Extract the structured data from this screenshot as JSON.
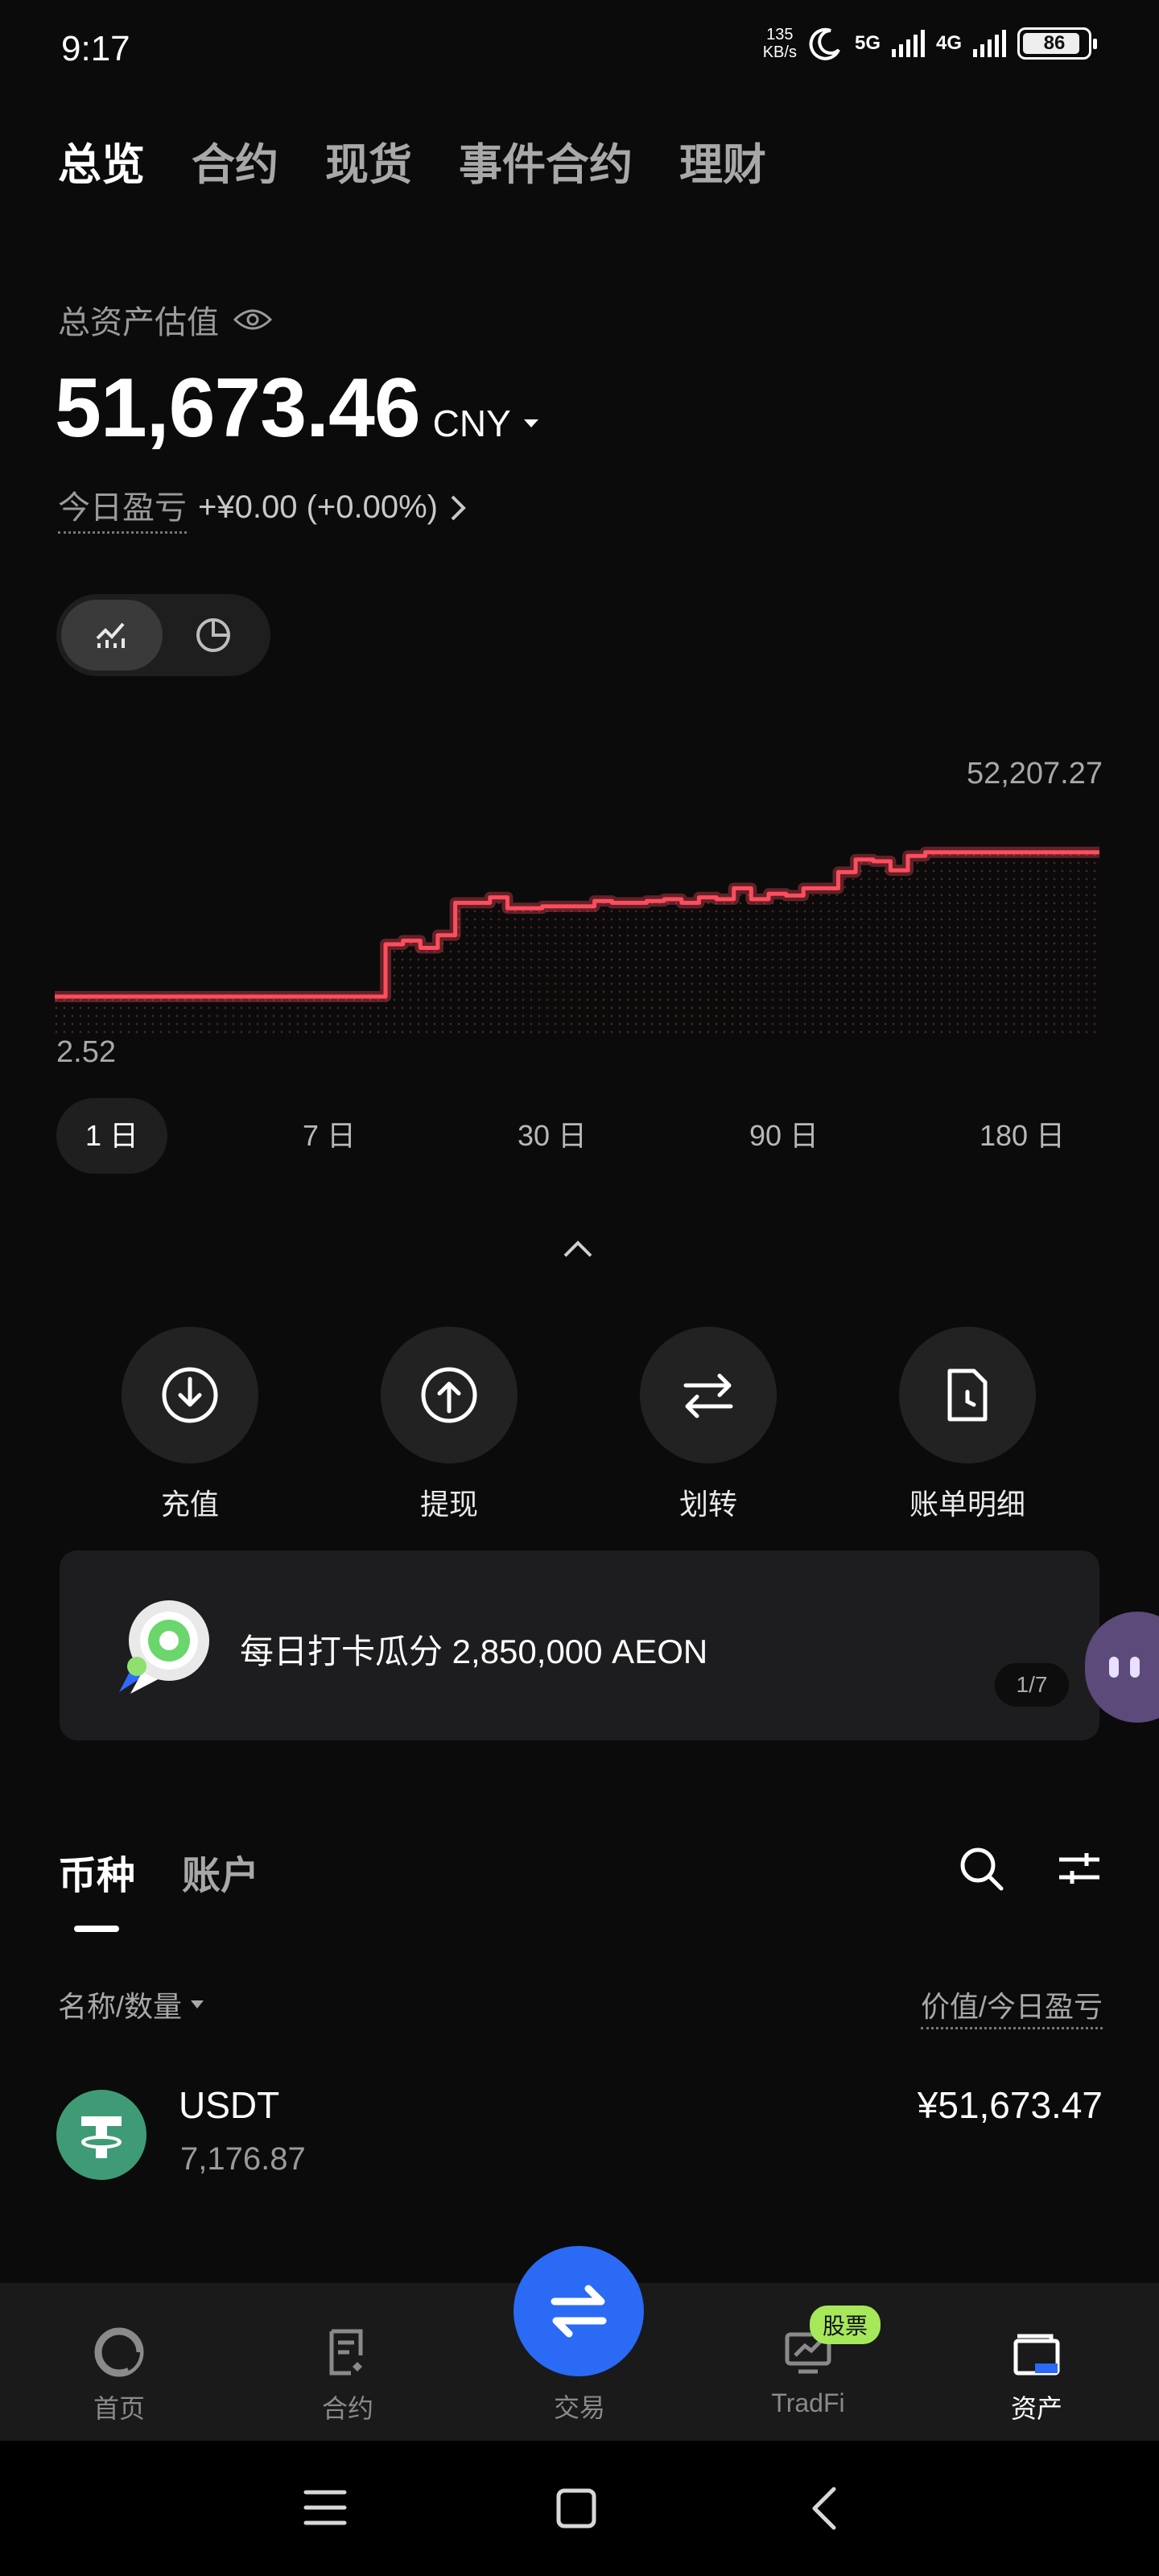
{
  "status": {
    "time": "9:17",
    "net_speed": "135\nKB/s",
    "net1": "5G",
    "net2": "4G",
    "battery": "86"
  },
  "top_tabs": [
    {
      "label": "总览",
      "active": true
    },
    {
      "label": "合约",
      "active": false
    },
    {
      "label": "现货",
      "active": false
    },
    {
      "label": "事件合约",
      "active": false
    },
    {
      "label": "理财",
      "active": false
    }
  ],
  "overview": {
    "asset_label": "总资产估值",
    "total_value": "51,673.46",
    "currency": "CNY",
    "pnl_label": "今日盈亏",
    "pnl_value": "+¥0.00 (+0.00%)"
  },
  "chart_data": {
    "type": "line",
    "max_label": "52,207.27",
    "min_label": "2.52",
    "ylim": [
      2.52,
      52207.27
    ],
    "color": "#ff4d5e",
    "x": [
      0,
      1,
      2,
      3,
      4,
      5,
      6,
      7,
      8,
      9,
      10,
      11,
      12,
      13,
      14,
      15,
      16,
      17,
      18,
      19,
      20,
      21,
      22,
      23,
      24,
      25,
      26,
      27,
      28,
      29,
      30,
      31,
      32,
      33,
      34,
      35,
      36,
      37,
      38,
      39,
      40,
      41,
      42,
      43,
      44,
      45,
      46,
      47,
      48,
      49,
      50,
      51,
      52,
      53,
      54,
      55,
      56,
      57,
      58,
      59,
      60
    ],
    "values": [
      2.5,
      2.5,
      2.5,
      2.5,
      2.5,
      2.5,
      2.5,
      2.5,
      2.5,
      2.5,
      2.5,
      2.5,
      2.5,
      2.5,
      2.5,
      2.5,
      2.5,
      2.5,
      2.5,
      14500,
      15500,
      13500,
      17000,
      26000,
      26000,
      27500,
      24500,
      24500,
      25000,
      25000,
      25000,
      26500,
      26000,
      26000,
      26500,
      27000,
      26000,
      27500,
      27000,
      30000,
      27000,
      28500,
      28000,
      30000,
      30000,
      34500,
      38000,
      37500,
      35000,
      39000,
      40000,
      40000,
      40000,
      40000,
      40000,
      40000,
      40000,
      40000,
      40000,
      40000,
      40000
    ]
  },
  "range_tabs": [
    {
      "label": "1 日",
      "active": true
    },
    {
      "label": "7 日",
      "active": false
    },
    {
      "label": "30 日",
      "active": false
    },
    {
      "label": "90 日",
      "active": false
    },
    {
      "label": "180 日",
      "active": false
    }
  ],
  "actions": [
    {
      "label": "充值",
      "icon": "deposit-icon"
    },
    {
      "label": "提现",
      "icon": "withdraw-icon"
    },
    {
      "label": "划转",
      "icon": "transfer-icon"
    },
    {
      "label": "账单明细",
      "icon": "bill-icon"
    }
  ],
  "banner": {
    "text": "每日打卡瓜分 2,850,000 AEON",
    "page": "1/7"
  },
  "asset_tabs": [
    {
      "label": "币种",
      "active": true
    },
    {
      "label": "账户",
      "active": false
    }
  ],
  "columns": {
    "left": "名称/数量",
    "right": "价值/今日盈亏"
  },
  "coins": [
    {
      "name": "USDT",
      "quantity": "7,176.87",
      "value": "¥51,673.47"
    }
  ],
  "bottom_nav": [
    {
      "label": "首页",
      "active": false
    },
    {
      "label": "合约",
      "active": false
    },
    {
      "label": "交易",
      "active": false
    },
    {
      "label": "TradFi",
      "active": false,
      "badge": "股票"
    },
    {
      "label": "资产",
      "active": true
    }
  ]
}
